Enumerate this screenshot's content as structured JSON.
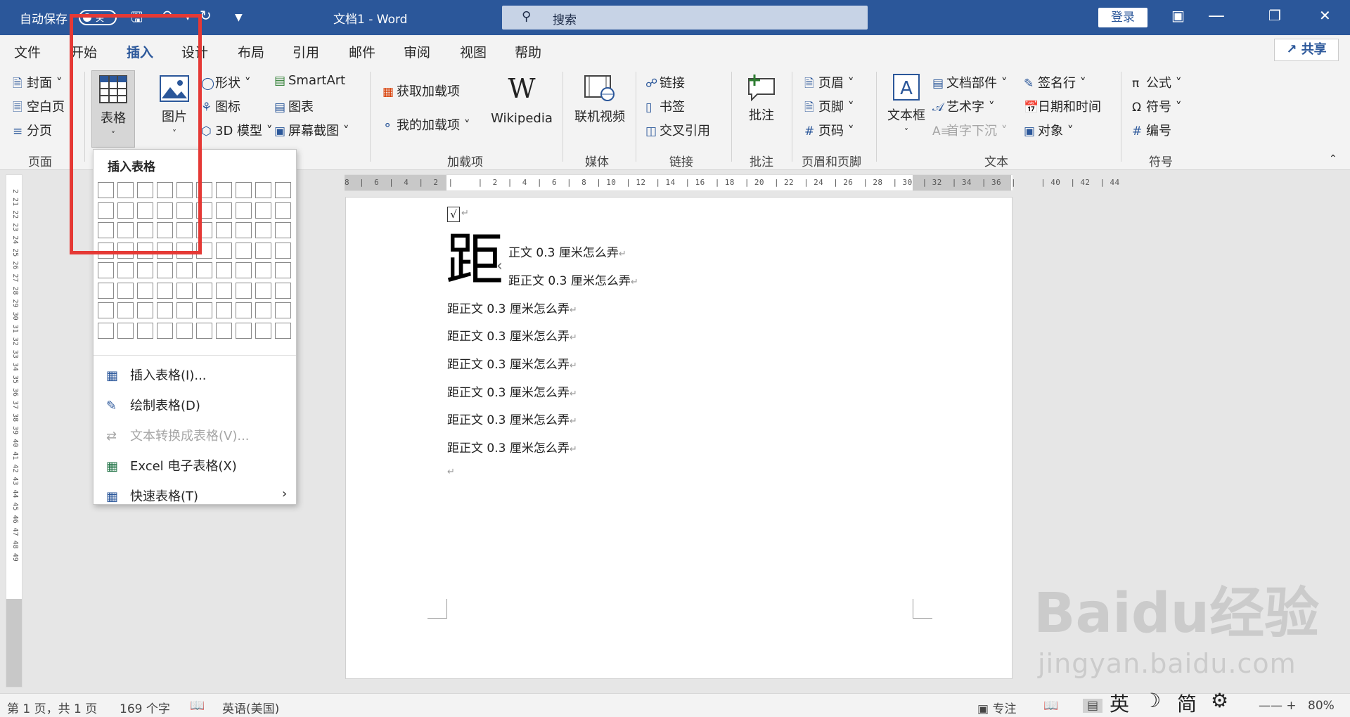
{
  "titlebar": {
    "autosave": "自动保存",
    "autosave_state": "关",
    "doc_title": "文档1  -  Word",
    "search_placeholder": "搜索",
    "login": "登录"
  },
  "tabs": [
    "文件",
    "开始",
    "插入",
    "设计",
    "布局",
    "引用",
    "邮件",
    "审阅",
    "视图",
    "帮助"
  ],
  "active_tab": "插入",
  "share": "共享",
  "ribbon": {
    "pages": {
      "cover": "封面",
      "blank": "空白页",
      "break": "分页",
      "group": "页面"
    },
    "table": {
      "label": "表格"
    },
    "picture": {
      "label": "图片"
    },
    "illus": {
      "shapes": "形状",
      "icons": "图标",
      "model3d": "3D 模型",
      "smartart": "SmartArt",
      "chart": "图表",
      "screenshot": "屏幕截图"
    },
    "addins": {
      "get": "获取加载项",
      "mine": "我的加载项",
      "wiki": "Wikipedia",
      "group": "加载项"
    },
    "media": {
      "video": "联机视频",
      "group": "媒体"
    },
    "links": {
      "link": "链接",
      "bookmark": "书签",
      "xref": "交叉引用",
      "group": "链接"
    },
    "comments": {
      "comment": "批注",
      "group": "批注"
    },
    "hf": {
      "header": "页眉",
      "footer": "页脚",
      "pagenum": "页码",
      "group": "页眉和页脚"
    },
    "text": {
      "textbox": "文本框",
      "quickparts": "文档部件",
      "wordart": "艺术字",
      "dropcap": "首字下沉",
      "sigline": "签名行",
      "datetime": "日期和时间",
      "object": "对象",
      "group": "文本"
    },
    "symbols": {
      "equation": "公式",
      "symbol": "符号",
      "number": "编号",
      "group": "符号"
    }
  },
  "dropdown": {
    "header": "插入表格",
    "items": [
      {
        "label": "插入表格(I)...",
        "icon": "table-icon",
        "enabled": true
      },
      {
        "label": "绘制表格(D)",
        "icon": "pencil-table-icon",
        "enabled": true
      },
      {
        "label": "文本转换成表格(V)...",
        "icon": "convert-icon",
        "enabled": false
      },
      {
        "label": "Excel 电子表格(X)",
        "icon": "excel-icon",
        "enabled": true
      },
      {
        "label": "快速表格(T)",
        "icon": "quick-table-icon",
        "enabled": true
      }
    ]
  },
  "ruler": {
    "h": "8  |  6  |  4  |  2  |     |  2  |  4  |  6  |  8  | 10  | 12  | 14  | 16  | 18  | 20  | 22  | 24  | 26  | 28  | 30  | 32  | 34  | 36  |     | 40  | 42  | 44",
    "v": "2  21  22  23  24  25  26  27  28  29  30  31  32  33  34  35  36  37  38  39  40  41  42  43  44  45  46  47  48  49"
  },
  "document": {
    "checkbox": "√",
    "dropcap": "距",
    "drop_lines": [
      "正文 0.3 厘米怎么弄",
      "距正文 0.3 厘米怎么弄"
    ],
    "lines": [
      "距正文 0.3 厘米怎么弄",
      "距正文 0.3 厘米怎么弄",
      "距正文 0.3 厘米怎么弄",
      "距正文 0.3 厘米怎么弄",
      "距正文 0.3 厘米怎么弄",
      "距正文 0.3 厘米怎么弄"
    ],
    "para_mark": "↵"
  },
  "status": {
    "page": "第 1 页，共 1 页",
    "words": "169 个字",
    "lang": "英语(美国)",
    "focus": "专注",
    "zoom": "80%"
  },
  "ime": {
    "lang": "英",
    "moon": "☽",
    "mode": "简",
    "settings": "⚙"
  },
  "watermark": {
    "brand": "Baidu经验",
    "url": "jingyan.baidu.com"
  },
  "colors": {
    "accent": "#2b579a",
    "highlight": "#e53935"
  }
}
